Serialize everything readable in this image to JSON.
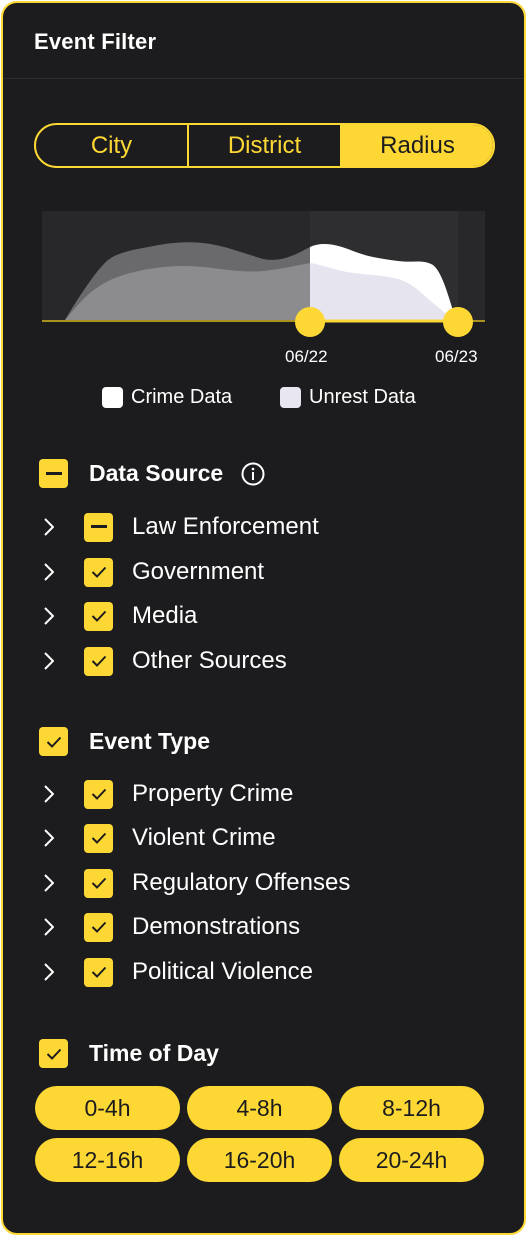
{
  "header": {
    "title": "Event Filter"
  },
  "segmented": {
    "options": [
      "City",
      "District",
      "Radius"
    ],
    "selected": "Radius"
  },
  "timeline": {
    "start_label": "06/22",
    "end_label": "06/23",
    "legend": [
      {
        "label": "Crime Data",
        "color": "#ffffff"
      },
      {
        "label": "Unrest Data",
        "color": "#e8e6f0"
      }
    ]
  },
  "data_source": {
    "label": "Data Source",
    "state": "indeterminate",
    "items": [
      {
        "label": "Law Enforcement",
        "state": "indeterminate"
      },
      {
        "label": "Government",
        "state": "checked"
      },
      {
        "label": "Media",
        "state": "checked"
      },
      {
        "label": "Other Sources",
        "state": "checked"
      }
    ]
  },
  "event_type": {
    "label": "Event Type",
    "state": "checked",
    "items": [
      {
        "label": "Property Crime",
        "state": "checked"
      },
      {
        "label": "Violent Crime",
        "state": "checked"
      },
      {
        "label": "Regulatory Offenses",
        "state": "checked"
      },
      {
        "label": "Demonstrations",
        "state": "checked"
      },
      {
        "label": "Political Violence",
        "state": "checked"
      }
    ]
  },
  "time_of_day": {
    "label": "Time of Day",
    "state": "checked",
    "chips": [
      "0-4h",
      "4-8h",
      "8-12h",
      "12-16h",
      "16-20h",
      "20-24h"
    ]
  },
  "colors": {
    "accent": "#fdd835",
    "background": "#1c1c1e",
    "text": "#ffffff"
  }
}
